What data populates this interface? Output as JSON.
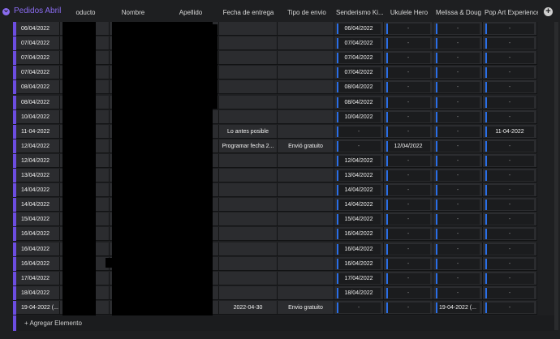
{
  "group": {
    "title": "Pedidos Abril"
  },
  "columns": {
    "producto": "oducto",
    "nombre": "Nombre",
    "apellido": "Apellido",
    "fecha_entrega": "Fecha de entrega",
    "tipo_envio": "Tipo de envio",
    "senderismo": "Senderismo Ki...",
    "ukulele": "Ukulele Hero",
    "melissa": "Melissa & Doug",
    "popart": "Pop Art Experience"
  },
  "add_column": "+",
  "rows": [
    {
      "date": "06/04/2022",
      "fecha": "",
      "envio": "",
      "s": "06/04/2022",
      "u": "-",
      "m": "-",
      "p": "-"
    },
    {
      "date": "07/04/2022",
      "fecha": "",
      "envio": "",
      "s": "07/04/2022",
      "u": "-",
      "m": "-",
      "p": "-"
    },
    {
      "date": "07/04/2022",
      "fecha": "",
      "envio": "",
      "s": "07/04/2022",
      "u": "-",
      "m": "-",
      "p": "-"
    },
    {
      "date": "07/04/2022",
      "fecha": "",
      "envio": "",
      "s": "07/04/2022",
      "u": "-",
      "m": "-",
      "p": "-"
    },
    {
      "date": "08/04/2022",
      "fecha": "",
      "envio": "",
      "s": "08/04/2022",
      "u": "-",
      "m": "-",
      "p": "-"
    },
    {
      "date": "08/04/2022",
      "fecha": "",
      "envio": "",
      "s": "08/04/2022",
      "u": "-",
      "m": "-",
      "p": "-"
    },
    {
      "date": "10/04/2022",
      "fecha": "",
      "envio": "",
      "s": "10/04/2022",
      "u": "-",
      "m": "-",
      "p": "-"
    },
    {
      "date": "11-04-2022",
      "fecha": "Lo antes posible",
      "envio": "",
      "s": "-",
      "u": "-",
      "m": "-",
      "p": "11-04-2022"
    },
    {
      "date": "12/04/2022",
      "fecha": "Programar fecha 2...",
      "envio": "Envió gratuito",
      "s": "-",
      "u": "12/04/2022",
      "m": "-",
      "p": "-"
    },
    {
      "date": "12/04/2022",
      "fecha": "",
      "envio": "",
      "s": "12/04/2022",
      "u": "-",
      "m": "-",
      "p": "-"
    },
    {
      "date": "13/04/2022",
      "fecha": "",
      "envio": "",
      "s": "13/04/2022",
      "u": "-",
      "m": "-",
      "p": "-"
    },
    {
      "date": "14/04/2022",
      "fecha": "",
      "envio": "",
      "s": "14/04/2022",
      "u": "-",
      "m": "-",
      "p": "-"
    },
    {
      "date": "14/04/2022",
      "fecha": "",
      "envio": "",
      "s": "14/04/2022",
      "u": "-",
      "m": "-",
      "p": "-"
    },
    {
      "date": "15/04/2022",
      "fecha": "",
      "envio": "",
      "s": "15/04/2022",
      "u": "-",
      "m": "-",
      "p": "-"
    },
    {
      "date": "16/04/2022",
      "fecha": "",
      "envio": "",
      "s": "16/04/2022",
      "u": "-",
      "m": "-",
      "p": "-"
    },
    {
      "date": "16/04/2022",
      "fecha": "",
      "envio": "",
      "s": "16/04/2022",
      "u": "-",
      "m": "-",
      "p": "-"
    },
    {
      "date": "16/04/2022",
      "fecha": "",
      "envio": "",
      "s": "16/04/2022",
      "u": "-",
      "m": "-",
      "p": "-"
    },
    {
      "date": "17/04/2022",
      "fecha": "",
      "envio": "",
      "s": "17/04/2022",
      "u": "-",
      "m": "-",
      "p": "-"
    },
    {
      "date": "18/04/2022",
      "fecha": "",
      "envio": "",
      "s": "18/04/2022",
      "u": "-",
      "m": "-",
      "p": "-"
    },
    {
      "date": "19-04-2022 (...",
      "fecha": "2022-04-30",
      "envio": "Envio gratuito",
      "s": "-",
      "u": "-",
      "m": "19-04-2022 (...",
      "p": "-"
    }
  ],
  "footer": {
    "add_label": "+ Agregar Elemento"
  },
  "colors": {
    "accent": "#6c4de0",
    "group_title": "#8a6cf0",
    "pill_bar": "#2a6ee6",
    "cell_bg": "#2b2c2f"
  }
}
